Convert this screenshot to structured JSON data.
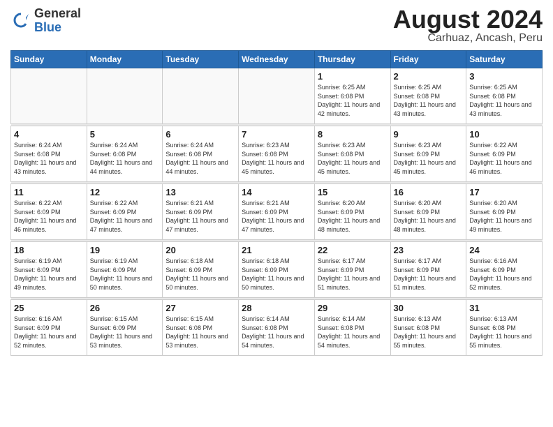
{
  "header": {
    "logo_general": "General",
    "logo_blue": "Blue",
    "month_year": "August 2024",
    "location": "Carhuaz, Ancash, Peru"
  },
  "days_of_week": [
    "Sunday",
    "Monday",
    "Tuesday",
    "Wednesday",
    "Thursday",
    "Friday",
    "Saturday"
  ],
  "weeks": [
    [
      {
        "day": "",
        "empty": true
      },
      {
        "day": "",
        "empty": true
      },
      {
        "day": "",
        "empty": true
      },
      {
        "day": "",
        "empty": true
      },
      {
        "day": "1",
        "sunrise": "6:25 AM",
        "sunset": "6:08 PM",
        "daylight": "11 hours and 42 minutes."
      },
      {
        "day": "2",
        "sunrise": "6:25 AM",
        "sunset": "6:08 PM",
        "daylight": "11 hours and 43 minutes."
      },
      {
        "day": "3",
        "sunrise": "6:25 AM",
        "sunset": "6:08 PM",
        "daylight": "11 hours and 43 minutes."
      }
    ],
    [
      {
        "day": "4",
        "sunrise": "6:24 AM",
        "sunset": "6:08 PM",
        "daylight": "11 hours and 43 minutes."
      },
      {
        "day": "5",
        "sunrise": "6:24 AM",
        "sunset": "6:08 PM",
        "daylight": "11 hours and 44 minutes."
      },
      {
        "day": "6",
        "sunrise": "6:24 AM",
        "sunset": "6:08 PM",
        "daylight": "11 hours and 44 minutes."
      },
      {
        "day": "7",
        "sunrise": "6:23 AM",
        "sunset": "6:08 PM",
        "daylight": "11 hours and 45 minutes."
      },
      {
        "day": "8",
        "sunrise": "6:23 AM",
        "sunset": "6:08 PM",
        "daylight": "11 hours and 45 minutes."
      },
      {
        "day": "9",
        "sunrise": "6:23 AM",
        "sunset": "6:09 PM",
        "daylight": "11 hours and 45 minutes."
      },
      {
        "day": "10",
        "sunrise": "6:22 AM",
        "sunset": "6:09 PM",
        "daylight": "11 hours and 46 minutes."
      }
    ],
    [
      {
        "day": "11",
        "sunrise": "6:22 AM",
        "sunset": "6:09 PM",
        "daylight": "11 hours and 46 minutes."
      },
      {
        "day": "12",
        "sunrise": "6:22 AM",
        "sunset": "6:09 PM",
        "daylight": "11 hours and 47 minutes."
      },
      {
        "day": "13",
        "sunrise": "6:21 AM",
        "sunset": "6:09 PM",
        "daylight": "11 hours and 47 minutes."
      },
      {
        "day": "14",
        "sunrise": "6:21 AM",
        "sunset": "6:09 PM",
        "daylight": "11 hours and 47 minutes."
      },
      {
        "day": "15",
        "sunrise": "6:20 AM",
        "sunset": "6:09 PM",
        "daylight": "11 hours and 48 minutes."
      },
      {
        "day": "16",
        "sunrise": "6:20 AM",
        "sunset": "6:09 PM",
        "daylight": "11 hours and 48 minutes."
      },
      {
        "day": "17",
        "sunrise": "6:20 AM",
        "sunset": "6:09 PM",
        "daylight": "11 hours and 49 minutes."
      }
    ],
    [
      {
        "day": "18",
        "sunrise": "6:19 AM",
        "sunset": "6:09 PM",
        "daylight": "11 hours and 49 minutes."
      },
      {
        "day": "19",
        "sunrise": "6:19 AM",
        "sunset": "6:09 PM",
        "daylight": "11 hours and 50 minutes."
      },
      {
        "day": "20",
        "sunrise": "6:18 AM",
        "sunset": "6:09 PM",
        "daylight": "11 hours and 50 minutes."
      },
      {
        "day": "21",
        "sunrise": "6:18 AM",
        "sunset": "6:09 PM",
        "daylight": "11 hours and 50 minutes."
      },
      {
        "day": "22",
        "sunrise": "6:17 AM",
        "sunset": "6:09 PM",
        "daylight": "11 hours and 51 minutes."
      },
      {
        "day": "23",
        "sunrise": "6:17 AM",
        "sunset": "6:09 PM",
        "daylight": "11 hours and 51 minutes."
      },
      {
        "day": "24",
        "sunrise": "6:16 AM",
        "sunset": "6:09 PM",
        "daylight": "11 hours and 52 minutes."
      }
    ],
    [
      {
        "day": "25",
        "sunrise": "6:16 AM",
        "sunset": "6:09 PM",
        "daylight": "11 hours and 52 minutes."
      },
      {
        "day": "26",
        "sunrise": "6:15 AM",
        "sunset": "6:09 PM",
        "daylight": "11 hours and 53 minutes."
      },
      {
        "day": "27",
        "sunrise": "6:15 AM",
        "sunset": "6:08 PM",
        "daylight": "11 hours and 53 minutes."
      },
      {
        "day": "28",
        "sunrise": "6:14 AM",
        "sunset": "6:08 PM",
        "daylight": "11 hours and 54 minutes."
      },
      {
        "day": "29",
        "sunrise": "6:14 AM",
        "sunset": "6:08 PM",
        "daylight": "11 hours and 54 minutes."
      },
      {
        "day": "30",
        "sunrise": "6:13 AM",
        "sunset": "6:08 PM",
        "daylight": "11 hours and 55 minutes."
      },
      {
        "day": "31",
        "sunrise": "6:13 AM",
        "sunset": "6:08 PM",
        "daylight": "11 hours and 55 minutes."
      }
    ]
  ],
  "labels": {
    "sunrise": "Sunrise:",
    "sunset": "Sunset:",
    "daylight": "Daylight:"
  }
}
